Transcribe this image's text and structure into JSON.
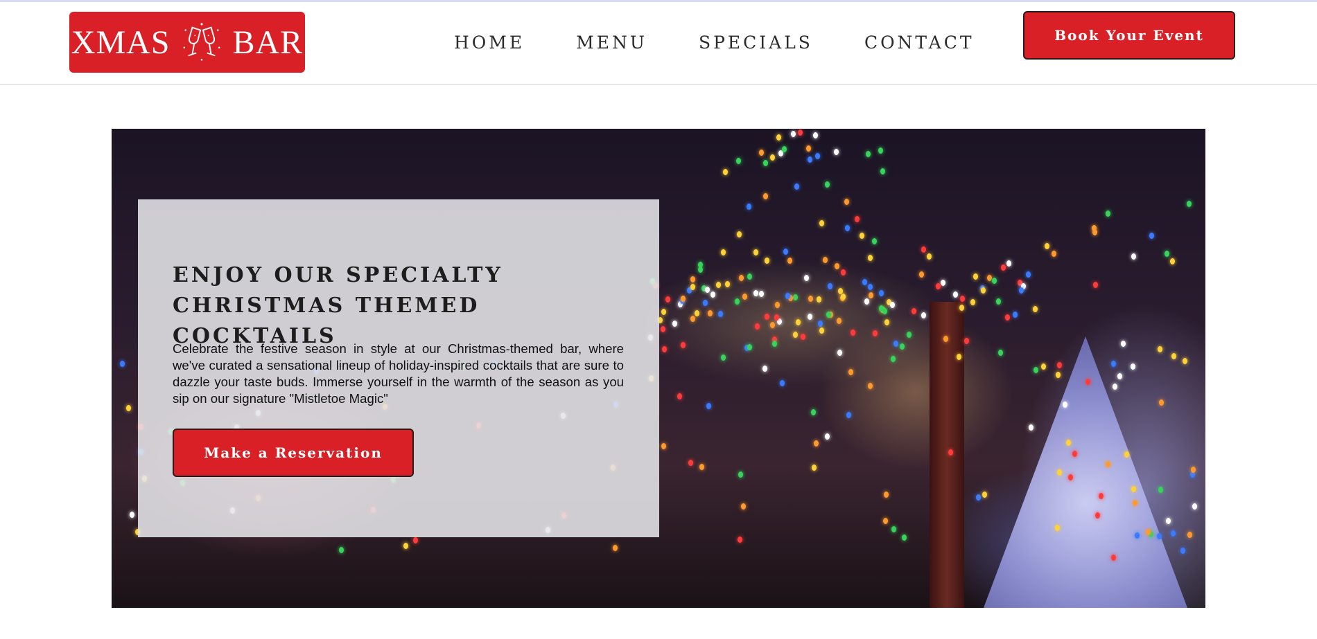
{
  "header": {
    "logo": {
      "left_text": "XMAS",
      "right_text": "BAR",
      "icon": "champagne-glasses-icon"
    },
    "nav": [
      {
        "label": "HOME"
      },
      {
        "label": "MENU"
      },
      {
        "label": "SPECIALS"
      },
      {
        "label": "CONTACT"
      }
    ],
    "cta_label": "Book Your Event"
  },
  "hero": {
    "title": "ENJOY OUR SPECIALTY CHRISTMAS THEMED COCKTAILS",
    "body": "Celebrate the festive season in style at our Christmas-themed bar, where we've curated a sensational lineup of holiday-inspired cocktails that are sure to dazzle your taste buds. Immerse yourself in the warmth of the season as you sip on our signature \"Mistletoe Magic\"",
    "cta_label": "Make a Reservation"
  },
  "colors": {
    "brand_red": "#d92027",
    "text_dark": "#1d1d1d",
    "card_bg": "#e6e6e9"
  }
}
